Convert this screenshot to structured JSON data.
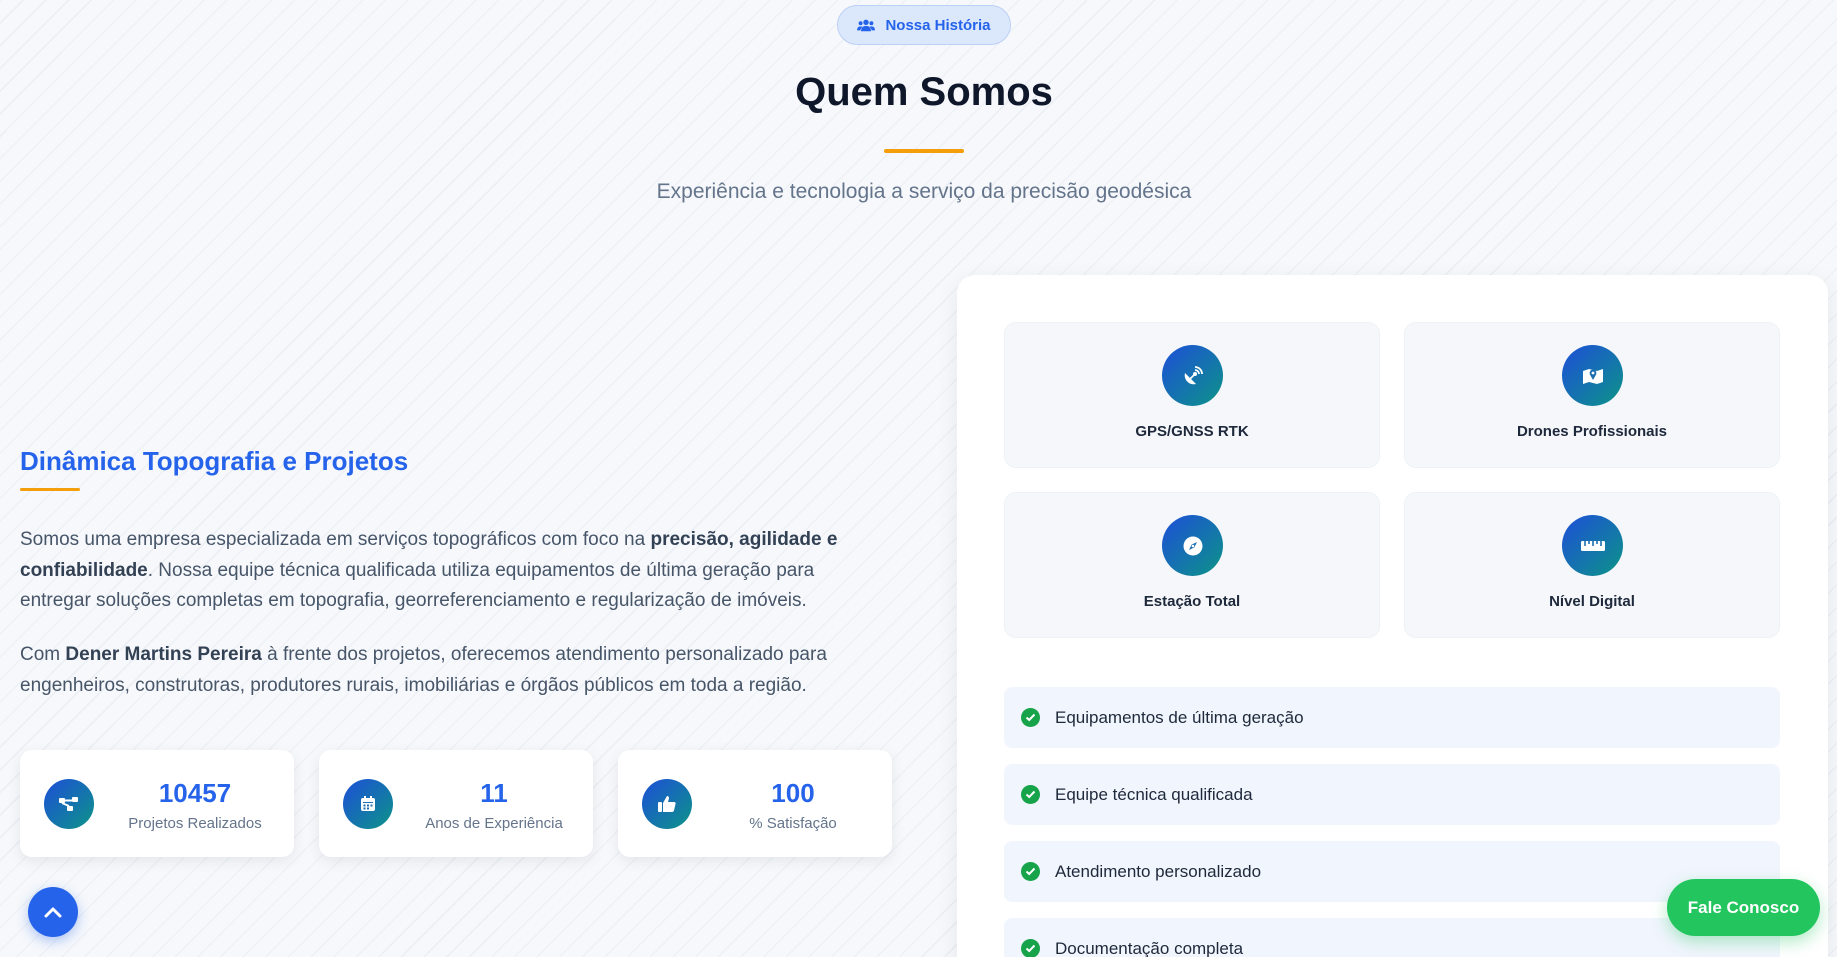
{
  "hero": {
    "badge_label": "Nossa História",
    "badge_icon": "users-icon",
    "title": "Quem Somos",
    "subtitle": "Experiência e tecnologia a serviço da precisão geodésica"
  },
  "about": {
    "company_name": "Dinâmica Topografia e Projetos",
    "p1_a": "Somos uma empresa especializada em serviços topográficos com foco na ",
    "p1_b": "precisão, agilidade e confiabilidade",
    "p1_c": ". Nossa equipe técnica qualificada utiliza equipamentos de última geração para entregar soluções completas em topografia, georreferenciamento e regularização de imóveis.",
    "p2_a": "Com ",
    "p2_b": "Dener Martins Pereira",
    "p2_c": " à frente dos projetos, oferecemos atendimento personalizado para engenheiros, construtoras, produtores rurais, imobiliárias e órgãos públicos em toda a região."
  },
  "stats": [
    {
      "value": "10457",
      "label": "Projetos Realizados",
      "icon": "project-diagram-icon"
    },
    {
      "value": "11",
      "label": "Anos de Experiência",
      "icon": "calendar-icon"
    },
    {
      "value": "100",
      "label": "% Satisfação",
      "icon": "thumbs-up-icon"
    }
  ],
  "equipment": [
    {
      "label": "GPS/GNSS RTK",
      "icon": "satellite-dish-icon"
    },
    {
      "label": "Drones Profissionais",
      "icon": "map-icon"
    },
    {
      "label": "Estação Total",
      "icon": "compass-icon"
    },
    {
      "label": "Nível Digital",
      "icon": "ruler-icon"
    }
  ],
  "features": [
    "Equipamentos de última geração",
    "Equipe técnica qualificada",
    "Atendimento personalizado",
    "Documentação completa"
  ],
  "buttons": {
    "contact_label": "Fale Conosco",
    "scroll_top_icon": "chevron-up-icon"
  },
  "colors": {
    "accent": "#2563eb",
    "highlight": "#f59e0b",
    "success": "#22c55e"
  }
}
